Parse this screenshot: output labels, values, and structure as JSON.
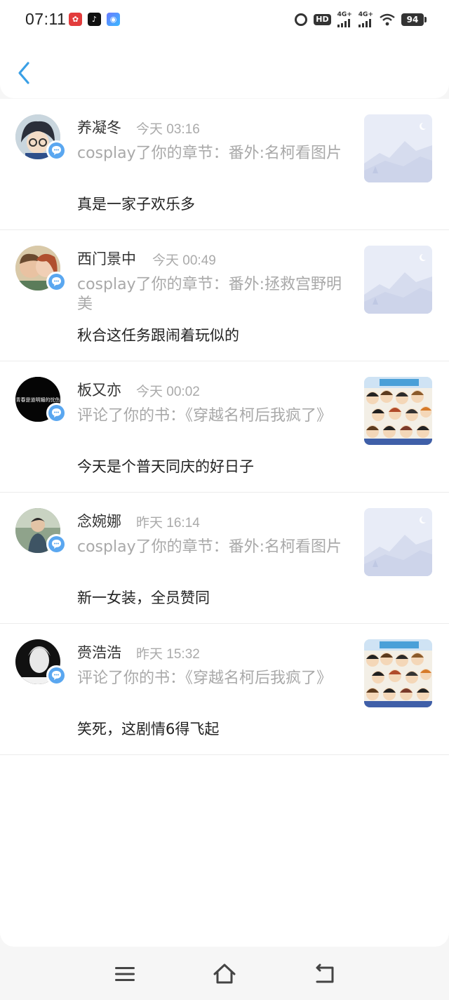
{
  "status_bar": {
    "time": "07:11",
    "hd": "HD",
    "network1": "4G+",
    "network2": "4G+",
    "battery": "94"
  },
  "header": {
    "back_icon": "chevron-left-icon"
  },
  "notifications": [
    {
      "username": "养凝冬",
      "time": "今天 03:16",
      "description": "cosplay了你的章节：番外:名柯看图片",
      "comment": "真是一家子欢乐多",
      "avatar": "avatar-cartoon-boy",
      "thumbnail": "placeholder-mountain"
    },
    {
      "username": "西门景中",
      "time": "今天 00:49",
      "description": "cosplay了你的章节：番外:拯救宫野明美",
      "comment": "秋合这任务跟闹着玩似的",
      "avatar": "avatar-couple-photo",
      "thumbnail": "placeholder-mountain"
    },
    {
      "username": "板又亦",
      "time": "今天 00:02",
      "description": "评论了你的书：《穿越名柯后我疯了》",
      "comment": "今天是个普天同庆的好日子",
      "avatar_text": "青春是道明媚的忧伤",
      "avatar": "avatar-black-text",
      "thumbnail": "book-cover-anime"
    },
    {
      "username": "念婉娜",
      "time": "昨天 16:14",
      "description": "cosplay了你的章节：番外:名柯看图片",
      "comment": "新一女装，全员赞同",
      "avatar": "avatar-man-outdoor",
      "thumbnail": "placeholder-mountain"
    },
    {
      "username": "赍浩浩",
      "time": "昨天 15:32",
      "description": "评论了你的书：《穿越名柯后我疯了》",
      "comment": "笑死，这剧情6得飞起",
      "avatar": "avatar-bw-photo",
      "thumbnail": "book-cover-anime"
    }
  ],
  "nav": {
    "menu_icon": "menu-icon",
    "home_icon": "home-icon",
    "back_icon": "back-arrow-icon"
  },
  "colors": {
    "accent_blue": "#3aa0e6",
    "badge_blue": "#5aa7f0",
    "muted_text": "#a9a9a9"
  }
}
